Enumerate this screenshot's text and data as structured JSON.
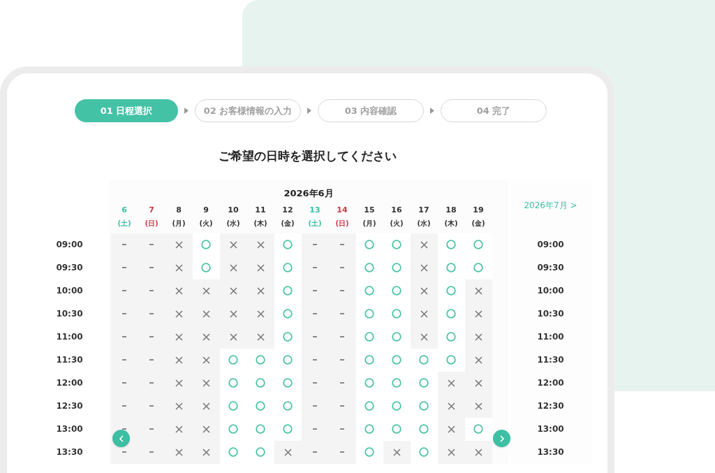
{
  "steps": [
    {
      "number": "01",
      "label": "日程選択",
      "selected": true
    },
    {
      "number": "02",
      "label": "お客様情報の入力",
      "selected": false
    },
    {
      "number": "03",
      "label": "内容確認",
      "selected": false
    },
    {
      "number": "04",
      "label": "完了",
      "selected": false
    }
  ],
  "heading": "ご希望の日時を選択してください",
  "calendar": {
    "month": "2026年6月",
    "next_month": "2026年7月 >",
    "days": [
      {
        "date": "6",
        "weekday": "(土)",
        "kind": "sat"
      },
      {
        "date": "7",
        "weekday": "(日)",
        "kind": "sun"
      },
      {
        "date": "8",
        "weekday": "(月)",
        "kind": "weekday"
      },
      {
        "date": "9",
        "weekday": "(火)",
        "kind": "weekday"
      },
      {
        "date": "10",
        "weekday": "(水)",
        "kind": "weekday"
      },
      {
        "date": "11",
        "weekday": "(木)",
        "kind": "weekday"
      },
      {
        "date": "12",
        "weekday": "(金)",
        "kind": "weekday"
      },
      {
        "date": "13",
        "weekday": "(土)",
        "kind": "sat"
      },
      {
        "date": "14",
        "weekday": "(日)",
        "kind": "sun"
      },
      {
        "date": "15",
        "weekday": "(月)",
        "kind": "weekday"
      },
      {
        "date": "16",
        "weekday": "(火)",
        "kind": "weekday"
      },
      {
        "date": "17",
        "weekday": "(水)",
        "kind": "weekday"
      },
      {
        "date": "18",
        "weekday": "(木)",
        "kind": "weekday"
      },
      {
        "date": "19",
        "weekday": "(金)",
        "kind": "weekday"
      }
    ],
    "rows": [
      {
        "time": "09:00",
        "right_time": "09:00",
        "slots": [
          {
            "kind": "closed"
          },
          {
            "kind": "closed"
          },
          {
            "kind": "full"
          },
          {
            "kind": "open"
          },
          {
            "kind": "full"
          },
          {
            "kind": "full"
          },
          {
            "kind": "open"
          },
          {
            "kind": "closed"
          },
          {
            "kind": "closed"
          },
          {
            "kind": "open"
          },
          {
            "kind": "open"
          },
          {
            "kind": "full"
          },
          {
            "kind": "open"
          },
          {
            "kind": "open"
          }
        ]
      },
      {
        "time": "09:30",
        "right_time": "09:30",
        "slots": [
          {
            "kind": "closed"
          },
          {
            "kind": "closed"
          },
          {
            "kind": "full"
          },
          {
            "kind": "open"
          },
          {
            "kind": "full"
          },
          {
            "kind": "full"
          },
          {
            "kind": "open"
          },
          {
            "kind": "closed"
          },
          {
            "kind": "closed"
          },
          {
            "kind": "open"
          },
          {
            "kind": "open"
          },
          {
            "kind": "full"
          },
          {
            "kind": "open"
          },
          {
            "kind": "open"
          }
        ]
      },
      {
        "time": "10:00",
        "right_time": "10:00",
        "slots": [
          {
            "kind": "closed"
          },
          {
            "kind": "closed"
          },
          {
            "kind": "full"
          },
          {
            "kind": "full"
          },
          {
            "kind": "full"
          },
          {
            "kind": "full"
          },
          {
            "kind": "open"
          },
          {
            "kind": "closed"
          },
          {
            "kind": "closed"
          },
          {
            "kind": "open"
          },
          {
            "kind": "open"
          },
          {
            "kind": "full"
          },
          {
            "kind": "open"
          },
          {
            "kind": "full"
          }
        ]
      },
      {
        "time": "10:30",
        "right_time": "10:30",
        "slots": [
          {
            "kind": "closed"
          },
          {
            "kind": "closed"
          },
          {
            "kind": "full"
          },
          {
            "kind": "full"
          },
          {
            "kind": "full"
          },
          {
            "kind": "full"
          },
          {
            "kind": "open"
          },
          {
            "kind": "closed"
          },
          {
            "kind": "closed"
          },
          {
            "kind": "open"
          },
          {
            "kind": "open"
          },
          {
            "kind": "full"
          },
          {
            "kind": "open"
          },
          {
            "kind": "full"
          }
        ]
      },
      {
        "time": "11:00",
        "right_time": "11:00",
        "slots": [
          {
            "kind": "closed"
          },
          {
            "kind": "closed"
          },
          {
            "kind": "full"
          },
          {
            "kind": "full"
          },
          {
            "kind": "full"
          },
          {
            "kind": "full"
          },
          {
            "kind": "open"
          },
          {
            "kind": "closed"
          },
          {
            "kind": "closed"
          },
          {
            "kind": "open"
          },
          {
            "kind": "open"
          },
          {
            "kind": "full"
          },
          {
            "kind": "open"
          },
          {
            "kind": "full"
          }
        ]
      },
      {
        "time": "11:30",
        "right_time": "11:30",
        "slots": [
          {
            "kind": "closed"
          },
          {
            "kind": "closed"
          },
          {
            "kind": "full"
          },
          {
            "kind": "full"
          },
          {
            "kind": "open"
          },
          {
            "kind": "open"
          },
          {
            "kind": "open"
          },
          {
            "kind": "closed"
          },
          {
            "kind": "closed"
          },
          {
            "kind": "open"
          },
          {
            "kind": "open"
          },
          {
            "kind": "open"
          },
          {
            "kind": "open"
          },
          {
            "kind": "full"
          }
        ]
      },
      {
        "time": "12:00",
        "right_time": "12:00",
        "slots": [
          {
            "kind": "closed"
          },
          {
            "kind": "closed"
          },
          {
            "kind": "full"
          },
          {
            "kind": "full"
          },
          {
            "kind": "open"
          },
          {
            "kind": "open"
          },
          {
            "kind": "open"
          },
          {
            "kind": "closed"
          },
          {
            "kind": "closed"
          },
          {
            "kind": "open"
          },
          {
            "kind": "open"
          },
          {
            "kind": "open"
          },
          {
            "kind": "full"
          },
          {
            "kind": "full"
          }
        ]
      },
      {
        "time": "12:30",
        "right_time": "12:30",
        "slots": [
          {
            "kind": "closed"
          },
          {
            "kind": "closed"
          },
          {
            "kind": "full"
          },
          {
            "kind": "full"
          },
          {
            "kind": "open"
          },
          {
            "kind": "open"
          },
          {
            "kind": "open"
          },
          {
            "kind": "closed"
          },
          {
            "kind": "closed"
          },
          {
            "kind": "open"
          },
          {
            "kind": "open"
          },
          {
            "kind": "open"
          },
          {
            "kind": "full"
          },
          {
            "kind": "full"
          }
        ]
      },
      {
        "time": "13:00",
        "right_time": "13:00",
        "slots": [
          {
            "kind": "closed"
          },
          {
            "kind": "closed"
          },
          {
            "kind": "full"
          },
          {
            "kind": "full"
          },
          {
            "kind": "open"
          },
          {
            "kind": "open"
          },
          {
            "kind": "open"
          },
          {
            "kind": "closed"
          },
          {
            "kind": "closed"
          },
          {
            "kind": "open"
          },
          {
            "kind": "open"
          },
          {
            "kind": "open"
          },
          {
            "kind": "full"
          },
          {
            "kind": "open"
          }
        ]
      },
      {
        "time": "13:30",
        "right_time": "13:30",
        "slots": [
          {
            "kind": "closed"
          },
          {
            "kind": "closed"
          },
          {
            "kind": "full"
          },
          {
            "kind": "full"
          },
          {
            "kind": "open"
          },
          {
            "kind": "open"
          },
          {
            "kind": "full"
          },
          {
            "kind": "closed"
          },
          {
            "kind": "closed"
          },
          {
            "kind": "open"
          },
          {
            "kind": "full"
          },
          {
            "kind": "open"
          },
          {
            "kind": "full"
          },
          {
            "kind": "full"
          }
        ]
      }
    ]
  }
}
